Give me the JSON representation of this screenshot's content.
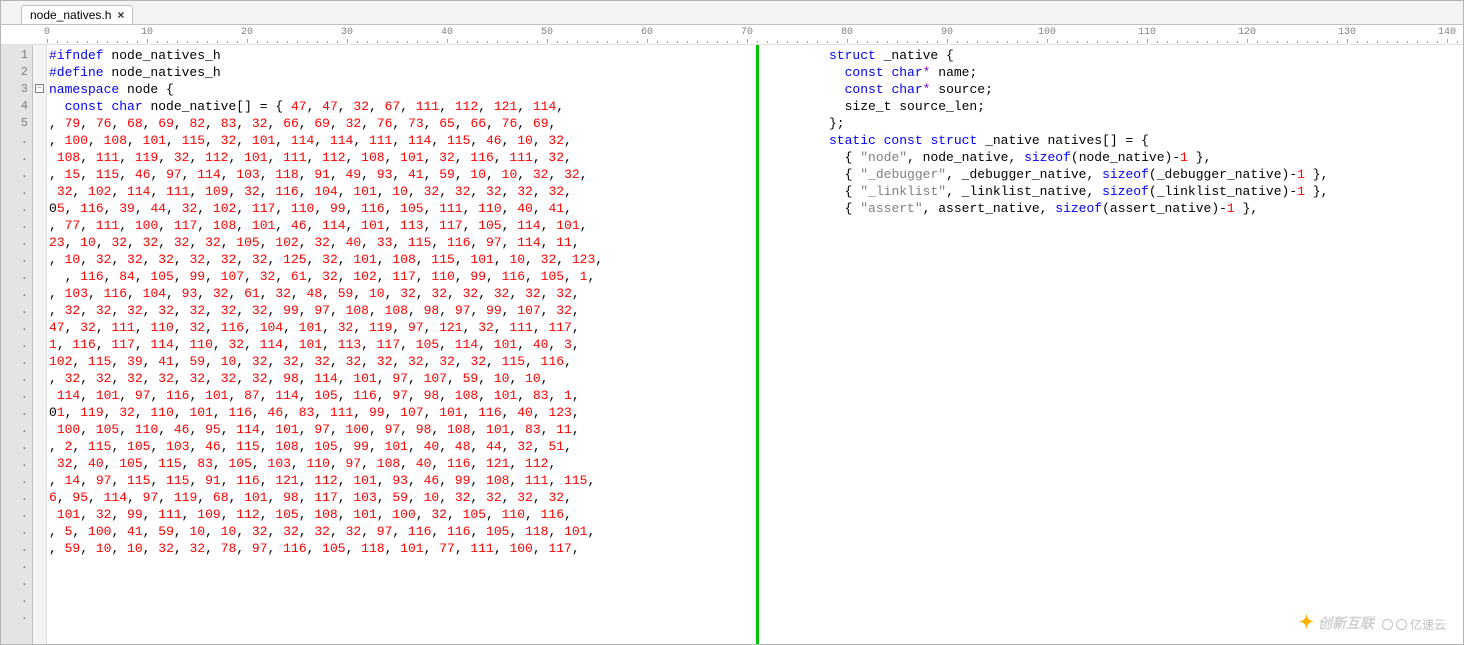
{
  "tab": {
    "title": "node_natives.h",
    "close": "×"
  },
  "ruler": {
    "marks": [
      0,
      10,
      20,
      30,
      40,
      50,
      60,
      70,
      80,
      90,
      100,
      110,
      120,
      130,
      140
    ],
    "char_w": 10,
    "offset": 14
  },
  "gutter": {
    "numbers": [
      "1",
      "2",
      "3",
      "4",
      "5"
    ],
    "dots": 29,
    "fold_line_index": 2
  },
  "left_code": {
    "lines": [
      [
        {
          "t": "#ifndef",
          "c": "kw"
        },
        {
          "t": " node_natives_h",
          "c": "id"
        }
      ],
      [
        {
          "t": "#define",
          "c": "kw"
        },
        {
          "t": " node_natives_h",
          "c": "id"
        }
      ],
      [
        {
          "t": "namespace",
          "c": "kw"
        },
        {
          "t": " node ",
          "c": "id"
        },
        {
          "t": "{",
          "c": "pl"
        }
      ],
      [
        {
          "t": "",
          "c": "pl"
        }
      ],
      [
        {
          "t": "  ",
          "c": "pl"
        },
        {
          "t": "const",
          "c": "kw"
        },
        {
          "t": " ",
          "c": "pl"
        },
        {
          "t": "char",
          "c": "kw"
        },
        {
          "t": " node_native",
          "c": "id"
        },
        {
          "t": "[]",
          "c": "pl"
        },
        {
          "t": " ",
          "c": "pl"
        },
        {
          "t": "=",
          "c": "pl"
        },
        {
          "t": " ",
          "c": "pl"
        },
        {
          "t": "{",
          "c": "pl"
        },
        {
          "t": " ",
          "c": "pl"
        },
        {
          "t": "47",
          "c": "num"
        },
        {
          "t": ", ",
          "c": "pl"
        },
        {
          "t": "47",
          "c": "num"
        },
        {
          "t": ", ",
          "c": "pl"
        },
        {
          "t": "32",
          "c": "num"
        },
        {
          "t": ", ",
          "c": "pl"
        },
        {
          "t": "67",
          "c": "num"
        },
        {
          "t": ", ",
          "c": "pl"
        },
        {
          "t": "111",
          "c": "num"
        },
        {
          "t": ", ",
          "c": "pl"
        },
        {
          "t": "112",
          "c": "num"
        },
        {
          "t": ", ",
          "c": "pl"
        },
        {
          "t": "121",
          "c": "num"
        },
        {
          "t": ", ",
          "c": "pl"
        },
        {
          "t": "114",
          "c": "num"
        },
        {
          "t": ",",
          "c": "pl"
        }
      ]
    ],
    "wrap_rows": [
      [
        79,
        76,
        68,
        69,
        82,
        83,
        32,
        66,
        69,
        32,
        76,
        73,
        65,
        66,
        76,
        69
      ],
      [
        100,
        108,
        101,
        115,
        32,
        101,
        114,
        114,
        111,
        114,
        115,
        46,
        10,
        32
      ],
      [
        108,
        111,
        119,
        32,
        112,
        101,
        111,
        112,
        108,
        101,
        32,
        116,
        111,
        32
      ],
      [
        15,
        115,
        46,
        97,
        114,
        103,
        118,
        91,
        49,
        93,
        41,
        59,
        10,
        10,
        32,
        32
      ],
      [
        32,
        102,
        114,
        111,
        109,
        32,
        116,
        104,
        101,
        10,
        32,
        32,
        32,
        32,
        32
      ],
      [
        5,
        116,
        39,
        44,
        32,
        102,
        117,
        110,
        99,
        116,
        105,
        111,
        110,
        40,
        41
      ],
      [
        77,
        111,
        100,
        117,
        108,
        101,
        46,
        114,
        101,
        113,
        117,
        105,
        114,
        101
      ],
      [
        23,
        10,
        32,
        32,
        32,
        32,
        105,
        102,
        32,
        40,
        33,
        115,
        116,
        97,
        114,
        11
      ],
      [
        10,
        32,
        32,
        32,
        32,
        32,
        32,
        125,
        32,
        101,
        108,
        115,
        101,
        10,
        32,
        123
      ],
      [
        116,
        84,
        105,
        99,
        107,
        32,
        61,
        32,
        102,
        117,
        110,
        99,
        116,
        105,
        1
      ],
      [
        103,
        116,
        104,
        93,
        32,
        61,
        32,
        48,
        59,
        10,
        32,
        32,
        32,
        32,
        32,
        32
      ],
      [
        32,
        32,
        32,
        32,
        32,
        32,
        32,
        99,
        97,
        108,
        108,
        98,
        97,
        99,
        107,
        32
      ],
      [
        47,
        32,
        111,
        110,
        32,
        116,
        104,
        101,
        32,
        119,
        97,
        121,
        32,
        111,
        117
      ],
      [
        1,
        116,
        117,
        114,
        110,
        32,
        114,
        101,
        113,
        117,
        105,
        114,
        101,
        40,
        3
      ],
      [
        102,
        115,
        39,
        41,
        59,
        10,
        32,
        32,
        32,
        32,
        32,
        32,
        32,
        32,
        115,
        116
      ],
      [
        32,
        32,
        32,
        32,
        32,
        32,
        32,
        98,
        114,
        101,
        97,
        107,
        59,
        10,
        10
      ],
      [
        114,
        101,
        97,
        116,
        101,
        87,
        114,
        105,
        116,
        97,
        98,
        108,
        101,
        83,
        1
      ],
      [
        1,
        119,
        32,
        110,
        101,
        116,
        46,
        83,
        111,
        99,
        107,
        101,
        116,
        40,
        123
      ],
      [
        100,
        105,
        110,
        46,
        95,
        114,
        101,
        97,
        100,
        97,
        98,
        108,
        101,
        83,
        11
      ],
      [
        2,
        115,
        105,
        103,
        46,
        115,
        108,
        105,
        99,
        101,
        40,
        48,
        44,
        32,
        51
      ],
      [
        32,
        40,
        105,
        115,
        83,
        105,
        103,
        110,
        97,
        108,
        40,
        116,
        121,
        112
      ],
      [
        14,
        97,
        115,
        115,
        91,
        116,
        121,
        112,
        101,
        93,
        46,
        99,
        108,
        111,
        115
      ],
      [
        6,
        95,
        114,
        97,
        119,
        68,
        101,
        98,
        117,
        103,
        59,
        10,
        32,
        32,
        32,
        32
      ],
      [
        101,
        32,
        99,
        111,
        109,
        112,
        105,
        108,
        101,
        100,
        32,
        105,
        110,
        116
      ],
      [
        5,
        100,
        41,
        59,
        10,
        10,
        32,
        32,
        32,
        32,
        97,
        116,
        116,
        105,
        118,
        101
      ],
      [
        59,
        10,
        10,
        32,
        32,
        78,
        97,
        116,
        105,
        118,
        101,
        77,
        111,
        100,
        117
      ]
    ],
    "row_prefixes": [
      ", ",
      ", ",
      " ",
      ", ",
      " ",
      "0",
      ", ",
      "",
      ", ",
      "  , ",
      ", ",
      ", ",
      "",
      "",
      "",
      ", ",
      " ",
      "0",
      " ",
      ", ",
      " ",
      ", ",
      "",
      " ",
      ", ",
      ", ",
      "",
      ""
    ]
  },
  "right_code": {
    "lines": [
      [
        {
          "t": "struct",
          "c": "kw"
        },
        {
          "t": " _native ",
          "c": "id"
        },
        {
          "t": "{",
          "c": "pl"
        }
      ],
      [
        {
          "t": "  ",
          "c": "pl"
        },
        {
          "t": "const",
          "c": "kw"
        },
        {
          "t": " ",
          "c": "pl"
        },
        {
          "t": "char",
          "c": "kw"
        },
        {
          "t": "*",
          "c": "op"
        },
        {
          "t": " name",
          "c": "id"
        },
        {
          "t": ";",
          "c": "pl"
        }
      ],
      [
        {
          "t": "  ",
          "c": "pl"
        },
        {
          "t": "const",
          "c": "kw"
        },
        {
          "t": " ",
          "c": "pl"
        },
        {
          "t": "char",
          "c": "kw"
        },
        {
          "t": "*",
          "c": "op"
        },
        {
          "t": " source",
          "c": "id"
        },
        {
          "t": ";",
          "c": "pl"
        }
      ],
      [
        {
          "t": "  size_t source_len",
          "c": "id"
        },
        {
          "t": ";",
          "c": "pl"
        }
      ],
      [
        {
          "t": "};",
          "c": "pl"
        }
      ],
      [
        {
          "t": "",
          "c": "pl"
        }
      ],
      [
        {
          "t": "static",
          "c": "kw"
        },
        {
          "t": " ",
          "c": "pl"
        },
        {
          "t": "const",
          "c": "kw"
        },
        {
          "t": " ",
          "c": "pl"
        },
        {
          "t": "struct",
          "c": "kw"
        },
        {
          "t": " _native natives",
          "c": "id"
        },
        {
          "t": "[]",
          "c": "pl"
        },
        {
          "t": " ",
          "c": "pl"
        },
        {
          "t": "=",
          "c": "pl"
        },
        {
          "t": " ",
          "c": "pl"
        },
        {
          "t": "{",
          "c": "pl"
        }
      ],
      [
        {
          "t": "",
          "c": "pl"
        }
      ],
      [
        {
          "t": "  ",
          "c": "pl"
        },
        {
          "t": "{",
          "c": "pl"
        },
        {
          "t": " ",
          "c": "pl"
        },
        {
          "t": "\"node\"",
          "c": "str"
        },
        {
          "t": ", node_native, ",
          "c": "id"
        },
        {
          "t": "sizeof",
          "c": "kw"
        },
        {
          "t": "(",
          "c": "pl"
        },
        {
          "t": "node_native",
          "c": "id"
        },
        {
          "t": ")",
          "c": "pl"
        },
        {
          "t": "-",
          "c": "pl"
        },
        {
          "t": "1",
          "c": "num"
        },
        {
          "t": " ",
          "c": "pl"
        },
        {
          "t": "},",
          "c": "pl"
        }
      ],
      [
        {
          "t": "",
          "c": "pl"
        }
      ],
      [
        {
          "t": "  ",
          "c": "pl"
        },
        {
          "t": "{",
          "c": "pl"
        },
        {
          "t": " ",
          "c": "pl"
        },
        {
          "t": "\"_debugger\"",
          "c": "str"
        },
        {
          "t": ", _debugger_native, ",
          "c": "id"
        },
        {
          "t": "sizeof",
          "c": "kw"
        },
        {
          "t": "(",
          "c": "pl"
        },
        {
          "t": "_debugger_native",
          "c": "id"
        },
        {
          "t": ")",
          "c": "pl"
        },
        {
          "t": "-",
          "c": "pl"
        },
        {
          "t": "1",
          "c": "num"
        },
        {
          "t": " ",
          "c": "pl"
        },
        {
          "t": "},",
          "c": "pl"
        }
      ],
      [
        {
          "t": "",
          "c": "pl"
        }
      ],
      [
        {
          "t": "  ",
          "c": "pl"
        },
        {
          "t": "{",
          "c": "pl"
        },
        {
          "t": " ",
          "c": "pl"
        },
        {
          "t": "\"_linklist\"",
          "c": "str"
        },
        {
          "t": ", _linklist_native, ",
          "c": "id"
        },
        {
          "t": "sizeof",
          "c": "kw"
        },
        {
          "t": "(",
          "c": "pl"
        },
        {
          "t": "_linklist_native",
          "c": "id"
        },
        {
          "t": ")",
          "c": "pl"
        },
        {
          "t": "-",
          "c": "pl"
        },
        {
          "t": "1",
          "c": "num"
        },
        {
          "t": " ",
          "c": "pl"
        },
        {
          "t": "},",
          "c": "pl"
        }
      ],
      [
        {
          "t": "",
          "c": "pl"
        }
      ],
      [
        {
          "t": "  ",
          "c": "pl"
        },
        {
          "t": "{",
          "c": "pl"
        },
        {
          "t": " ",
          "c": "pl"
        },
        {
          "t": "\"assert\"",
          "c": "str"
        },
        {
          "t": ", assert_native, ",
          "c": "id"
        },
        {
          "t": "sizeof",
          "c": "kw"
        },
        {
          "t": "(",
          "c": "pl"
        },
        {
          "t": "assert_native",
          "c": "id"
        },
        {
          "t": ")",
          "c": "pl"
        },
        {
          "t": "-",
          "c": "pl"
        },
        {
          "t": "1",
          "c": "num"
        },
        {
          "t": " ",
          "c": "pl"
        },
        {
          "t": "},",
          "c": "pl"
        }
      ]
    ]
  },
  "watermarks": {
    "cx": "创新互联",
    "ysy": "亿速云"
  }
}
